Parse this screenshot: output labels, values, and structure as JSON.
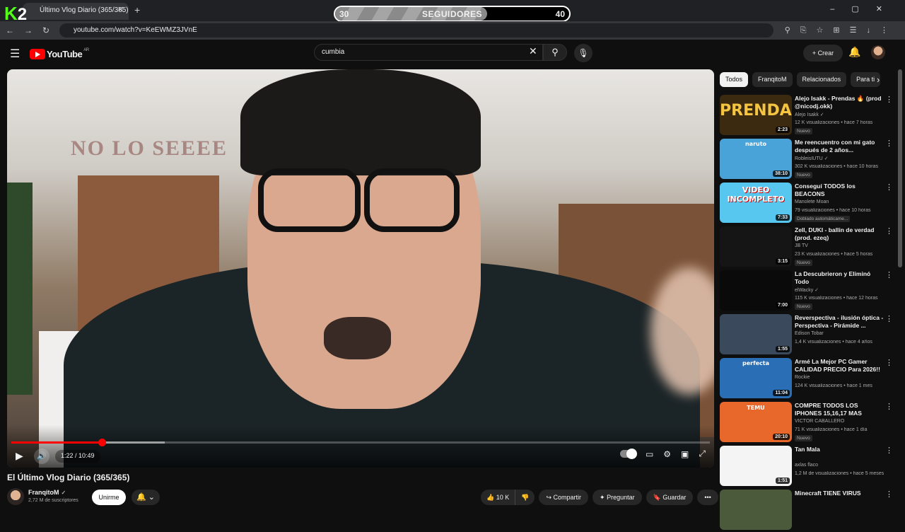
{
  "overlay": {
    "logo_k": "K",
    "logo_num": "2",
    "followers_label": "SEGUIDORES",
    "followers_min": "30",
    "followers_max": "40",
    "followers_progress": 0.65
  },
  "browser": {
    "tab_title": "Último Vlog Diario (365/365)",
    "tab_close": "✕",
    "new_tab": "+",
    "window_controls": "–▢✕",
    "nav_icons": "←→↻",
    "url": "youtube.com/watch?v=KeEWMZ3JVnE",
    "right_icons": "⚲⎘☆⊞☰↓⋮"
  },
  "header": {
    "logo_text": "YouTube",
    "region": "AR",
    "search_value": "cumbia",
    "create_label": "Crear"
  },
  "player": {
    "sign_text": "NO LO SEEEE",
    "current_time": "1:22 / 10:49",
    "played_fraction": 0.13,
    "buffered_fraction": 0.22
  },
  "video": {
    "title": "El Último Vlog Diario (365/365)",
    "channel": "FranqitoM",
    "subscribers": "2,72 M de suscriptores",
    "join_label": "Unirme",
    "likes": "10 K",
    "share_label": "Compartir",
    "ask_label": "Preguntar",
    "save_label": "Guardar",
    "more_label": "•••"
  },
  "sidebar": {
    "chips": [
      "Todos",
      "FranqitoM",
      "Relacionados",
      "Para ti"
    ],
    "recommendations": [
      {
        "title": "Alejo Isakk - Prendas 🔥 (prod @nicodj.okk)",
        "channel": "Alejo Isakk ✓",
        "meta": "12 K visualizaciones • hace 7 horas",
        "badge": "Nuevo",
        "duration": "2:23",
        "thumb_text": "PRENDAS",
        "thumb_color": "#3b2a10"
      },
      {
        "title": "Me reencuentro con mi gato después de 2 años...",
        "channel": "RobleisIUTU ✓",
        "meta": "302 K visualizaciones • hace 10 horas",
        "badge": "Nuevo",
        "duration": "38:10",
        "thumb_text": "naruto",
        "thumb_color": "#4aa3d8"
      },
      {
        "title": "Conseguí TODOS los BEACONS",
        "channel": "Manolete Moan",
        "meta": "79 visualizaciones • hace 10 horas",
        "badge": "Doblado automáticame...",
        "duration": "7:33",
        "thumb_text": "VIDEO INCOMPLETO",
        "thumb_color": "#58c7f0"
      },
      {
        "title": "Zell, DUKI - ballin de verdad (prod. ezeq)",
        "channel": "JB TV",
        "meta": "23 K visualizaciones • hace 5 horas",
        "badge": "Nuevo",
        "duration": "3:15",
        "thumb_text": "",
        "thumb_color": "#151515"
      },
      {
        "title": "La Descubrieron y Eliminó Todo",
        "channel": "elWacky ✓",
        "meta": "115 K visualizaciones • hace 12 horas",
        "badge": "Nuevo",
        "duration": "7:00",
        "thumb_text": "",
        "thumb_color": "#0a0a0a"
      },
      {
        "title": "Reverspectiva - ilusión óptica - Perspectiva - Pirámide ...",
        "channel": "Edison Tobar",
        "meta": "1,4 K visualizaciones • hace 4 años",
        "badge": "",
        "duration": "1:55",
        "thumb_text": "",
        "thumb_color": "#3a4a5c"
      },
      {
        "title": "Armé La Mejor PC Gamer CALIDAD PRECIO Para 2026!! ...",
        "channel": "Rockie",
        "meta": "124 K visualizaciones • hace 1 mes",
        "badge": "",
        "duration": "11:04",
        "thumb_text": "perfecta",
        "thumb_color": "#2a6fb6"
      },
      {
        "title": "COMPRE TODOS LOS IPHONES 15,16,17 MAS BARATOS DE ...",
        "channel": "VICTOR CABALLERO",
        "meta": "71 K visualizaciones • hace 1 día",
        "badge": "Nuevo",
        "duration": "20:10",
        "thumb_text": "TEMU",
        "thumb_color": "#e8672a"
      },
      {
        "title": "Tan Mala",
        "channel": "axlas flaco",
        "meta": "1,2 M de visualizaciones • hace 5 meses",
        "badge": "",
        "duration": "1:51",
        "thumb_text": "",
        "thumb_color": "#f4f4f4"
      },
      {
        "title": "Minecraft TIENE VIRUS",
        "channel": "",
        "meta": "",
        "badge": "",
        "duration": "",
        "thumb_text": "",
        "thumb_color": "#4a5a3a"
      }
    ]
  }
}
